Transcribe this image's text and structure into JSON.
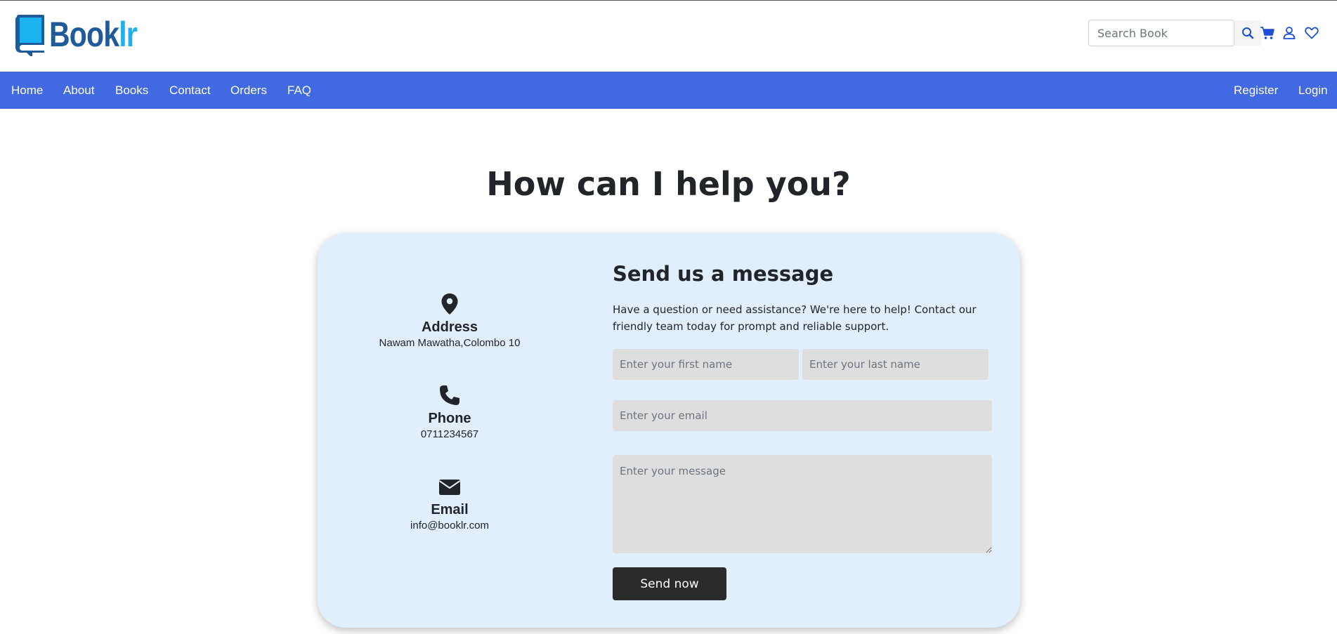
{
  "brand": {
    "name_part1": "Book",
    "name_part2": "lr",
    "logo_color": "#1f5a99",
    "accent_color": "#1ab2ef"
  },
  "header": {
    "search_placeholder": "Search Book",
    "icons": [
      "search-icon",
      "cart-icon",
      "user-icon",
      "heart-icon"
    ]
  },
  "nav": {
    "color": "#4169e1",
    "left_items": [
      {
        "label": "Home"
      },
      {
        "label": "About"
      },
      {
        "label": "Books"
      },
      {
        "label": "Contact"
      },
      {
        "label": "Orders"
      },
      {
        "label": "FAQ"
      }
    ],
    "right_items": [
      {
        "label": "Register"
      },
      {
        "label": "Login"
      }
    ]
  },
  "page_title": "How can I help you?",
  "contact_info": [
    {
      "icon": "location-pin-icon",
      "label": "Address",
      "value": "Nawam Mawatha,Colombo 10"
    },
    {
      "icon": "phone-icon",
      "label": "Phone",
      "value": "0711234567"
    },
    {
      "icon": "envelope-icon",
      "label": "Email",
      "value": "info@booklr.com"
    }
  ],
  "form": {
    "title": "Send us a message",
    "description": "Have a question or need assistance? We're here to help! Contact our friendly team today for prompt and reliable support.",
    "first_name_placeholder": "Enter your first name",
    "last_name_placeholder": "Enter your last name",
    "email_placeholder": "Enter your email",
    "message_placeholder": "Enter your message",
    "submit_label": "Send now"
  }
}
